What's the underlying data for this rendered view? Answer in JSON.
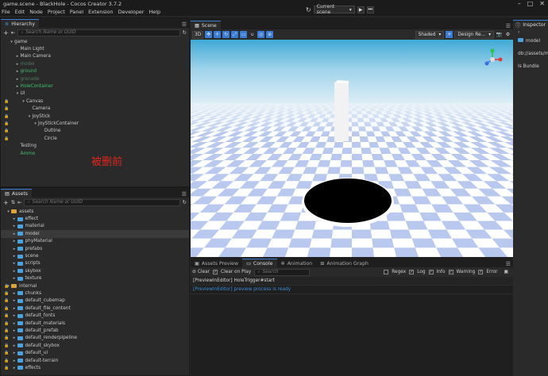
{
  "window": {
    "title": "game.scene - BlackHole - Cocos Creator 3.7.2"
  },
  "menu": [
    "File",
    "Edit",
    "Node",
    "Project",
    "Panel",
    "Extension",
    "Developer",
    "Help"
  ],
  "toolbar": {
    "scene_select": "Current scene"
  },
  "hierarchy": {
    "tab": "Hierarchy",
    "search_placeholder": "Search Name or UUID",
    "nodes": [
      {
        "label": "game",
        "depth": 0,
        "arrow": "v",
        "lock": false,
        "color": "normal"
      },
      {
        "label": "Main Light",
        "depth": 1,
        "arrow": "",
        "lock": false,
        "color": "normal"
      },
      {
        "label": "Main Camera",
        "depth": 1,
        "arrow": ">",
        "lock": false,
        "color": "normal"
      },
      {
        "label": "model",
        "depth": 1,
        "arrow": ">",
        "lock": false,
        "color": "dim"
      },
      {
        "label": "ground",
        "depth": 1,
        "arrow": ">",
        "lock": false,
        "color": "green"
      },
      {
        "label": "grenade",
        "depth": 1,
        "arrow": ">",
        "lock": false,
        "color": "dim"
      },
      {
        "label": "HoleContainer",
        "depth": 1,
        "arrow": ">",
        "lock": false,
        "color": "green"
      },
      {
        "label": "UI",
        "depth": 1,
        "arrow": "v",
        "lock": false,
        "color": "normal"
      },
      {
        "label": "Canvas",
        "depth": 2,
        "arrow": "v",
        "lock": true,
        "color": "normal"
      },
      {
        "label": "Camera",
        "depth": 3,
        "arrow": "",
        "lock": true,
        "color": "normal"
      },
      {
        "label": "JoyStick",
        "depth": 3,
        "arrow": "v",
        "lock": true,
        "color": "normal"
      },
      {
        "label": "JoyStickContainer",
        "depth": 4,
        "arrow": "v",
        "lock": true,
        "color": "normal"
      },
      {
        "label": "Outline",
        "depth": 5,
        "arrow": "",
        "lock": true,
        "color": "normal"
      },
      {
        "label": "Circle",
        "depth": 5,
        "arrow": "",
        "lock": true,
        "color": "normal"
      },
      {
        "label": "Testing",
        "depth": 1,
        "arrow": "",
        "lock": false,
        "color": "normal"
      },
      {
        "label": "Ammo",
        "depth": 1,
        "arrow": "",
        "lock": false,
        "color": "green"
      }
    ],
    "annotation": "被删前"
  },
  "assets": {
    "tab": "Assets",
    "search_placeholder": "Search Name or UUID",
    "items": [
      {
        "label": "assets",
        "depth": 0,
        "arrow": "v",
        "folder": "yellow",
        "lock": false
      },
      {
        "label": "effect",
        "depth": 1,
        "arrow": ">",
        "folder": "blue",
        "lock": false
      },
      {
        "label": "material",
        "depth": 1,
        "arrow": ">",
        "folder": "blue",
        "lock": false
      },
      {
        "label": "model",
        "depth": 1,
        "arrow": ">",
        "folder": "blue",
        "lock": false,
        "selected": true
      },
      {
        "label": "phyMaterial",
        "depth": 1,
        "arrow": ">",
        "folder": "blue",
        "lock": false
      },
      {
        "label": "prefabs",
        "depth": 1,
        "arrow": ">",
        "folder": "blue",
        "lock": false
      },
      {
        "label": "scene",
        "depth": 1,
        "arrow": ">",
        "folder": "blue",
        "lock": false
      },
      {
        "label": "scripts",
        "depth": 1,
        "arrow": ">",
        "folder": "blue",
        "lock": false
      },
      {
        "label": "skybox",
        "depth": 1,
        "arrow": ">",
        "folder": "blue",
        "lock": false
      },
      {
        "label": "texture",
        "depth": 1,
        "arrow": ">",
        "folder": "blue",
        "lock": false
      },
      {
        "label": "internal",
        "depth": 0,
        "arrow": "v",
        "folder": "yellow",
        "lock": true
      },
      {
        "label": "chunks",
        "depth": 1,
        "arrow": ">",
        "folder": "blue",
        "lock": true
      },
      {
        "label": "default_cubemap",
        "depth": 1,
        "arrow": ">",
        "folder": "blue",
        "lock": true
      },
      {
        "label": "default_file_content",
        "depth": 1,
        "arrow": ">",
        "folder": "blue",
        "lock": true
      },
      {
        "label": "default_fonts",
        "depth": 1,
        "arrow": ">",
        "folder": "blue",
        "lock": true
      },
      {
        "label": "default_materials",
        "depth": 1,
        "arrow": ">",
        "folder": "blue",
        "lock": true
      },
      {
        "label": "default_prefab",
        "depth": 1,
        "arrow": ">",
        "folder": "blue",
        "lock": true
      },
      {
        "label": "default_renderpipeline",
        "depth": 1,
        "arrow": ">",
        "folder": "blue",
        "lock": true
      },
      {
        "label": "default_skybox",
        "depth": 1,
        "arrow": ">",
        "folder": "blue",
        "lock": true
      },
      {
        "label": "default_ui",
        "depth": 1,
        "arrow": ">",
        "folder": "blue",
        "lock": true
      },
      {
        "label": "default-terrain",
        "depth": 1,
        "arrow": ">",
        "folder": "blue",
        "lock": true
      },
      {
        "label": "effects",
        "depth": 1,
        "arrow": ">",
        "folder": "blue",
        "lock": true
      }
    ]
  },
  "scene": {
    "tab": "Scene",
    "mode_3d": "3D",
    "shading": "Shaded",
    "resolution": "Design Re..."
  },
  "console": {
    "tabs": [
      "Assets Preview",
      "Console",
      "Animation",
      "Animation Graph"
    ],
    "active_tab": "Console",
    "clear": "Clear",
    "clear_on_play": "Clear on Play",
    "search_placeholder": "Search",
    "regex": "Regex",
    "log": "Log",
    "info": "Info",
    "warning": "Warning",
    "error": "Error",
    "lines": [
      {
        "text": "[PreviewInEditor] HoleTrigger#start",
        "color": "#d8d8d8"
      },
      {
        "text": "[PreviewInEditor] preview process is ready",
        "color": "#3b8fd6"
      }
    ]
  },
  "inspector": {
    "tab": "Inspector",
    "rows": [
      "model",
      "db://assets/mo",
      "Is Bundle"
    ]
  }
}
